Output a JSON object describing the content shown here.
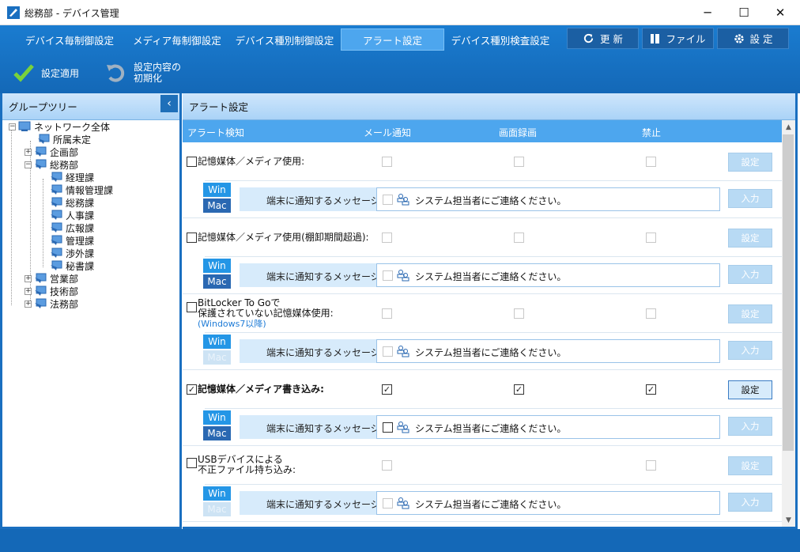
{
  "window": {
    "title": "総務部 - デバイス管理",
    "min": "─",
    "max": "☐",
    "close": "✕"
  },
  "tabs": [
    {
      "label": "デバイス毎制御設定"
    },
    {
      "label": "メディア毎制御設定"
    },
    {
      "label": "デバイス種別制御設定"
    },
    {
      "label": "アラート設定"
    },
    {
      "label": "デバイス種別検査設定"
    }
  ],
  "toolbar": {
    "refresh": "更 新",
    "file": "ファイル",
    "settings": "設 定"
  },
  "actions": {
    "apply": "設定適用",
    "reset_line1": "設定内容の",
    "reset_line2": "初期化"
  },
  "left_panel": {
    "title": "グループツリー",
    "collapse": "‹",
    "tree": [
      {
        "label": "ネットワーク全体"
      },
      {
        "label": "所属未定"
      },
      {
        "label": "企画部"
      },
      {
        "label": "総務部"
      },
      {
        "label": "経理課"
      },
      {
        "label": "情報管理課"
      },
      {
        "label": "総務課"
      },
      {
        "label": "人事課"
      },
      {
        "label": "広報課"
      },
      {
        "label": "管理課"
      },
      {
        "label": "渉外課"
      },
      {
        "label": "秘書課"
      },
      {
        "label": "営業部"
      },
      {
        "label": "技術部"
      },
      {
        "label": "法務部"
      }
    ]
  },
  "right_panel": {
    "title": "アラート設定",
    "columns": {
      "detect": "アラート検知",
      "mail": "メール通知",
      "screen": "画面録画",
      "prohibit": "禁止"
    }
  },
  "alerts": [
    {
      "line1": "記憶媒体／メディア使用:",
      "line2": "",
      "note": "",
      "checked": false,
      "mail": false,
      "screen": false,
      "prohibit": false,
      "has_screen": true,
      "active": false,
      "mac_enabled": true
    },
    {
      "line1": "記憶媒体／メディア使用(棚卸期間超過):",
      "line2": "",
      "note": "",
      "checked": false,
      "mail": false,
      "screen": false,
      "prohibit": false,
      "has_screen": true,
      "active": false,
      "mac_enabled": true
    },
    {
      "line1": "BitLocker To Goで",
      "line2": "保護されていない記憶媒体使用:",
      "note": "(Windows7以降)",
      "checked": false,
      "mail": false,
      "screen": false,
      "prohibit": false,
      "has_screen": true,
      "active": false,
      "mac_enabled": false
    },
    {
      "line1": "記憶媒体／メディア書き込み:",
      "line2": "",
      "note": "",
      "checked": true,
      "mail": true,
      "screen": true,
      "prohibit": true,
      "has_screen": true,
      "active": true,
      "mac_enabled": true
    },
    {
      "line1": "USBデバイスによる",
      "line2": "不正ファイル持ち込み:",
      "note": "",
      "checked": false,
      "mail": false,
      "screen": false,
      "prohibit": false,
      "has_screen": false,
      "active": false,
      "mac_enabled": false
    }
  ],
  "common": {
    "set_label": "設定",
    "input_label": "入力",
    "win": "Win",
    "mac": "Mac",
    "msg_label": "端末に通知するメッセージ:",
    "message": "システム担当者にご連絡ください。",
    "check_mark": "✓"
  },
  "colors": {
    "brand": "#1468b7",
    "tab_active": "#4da6ee",
    "header_light": "#aad3f7"
  }
}
